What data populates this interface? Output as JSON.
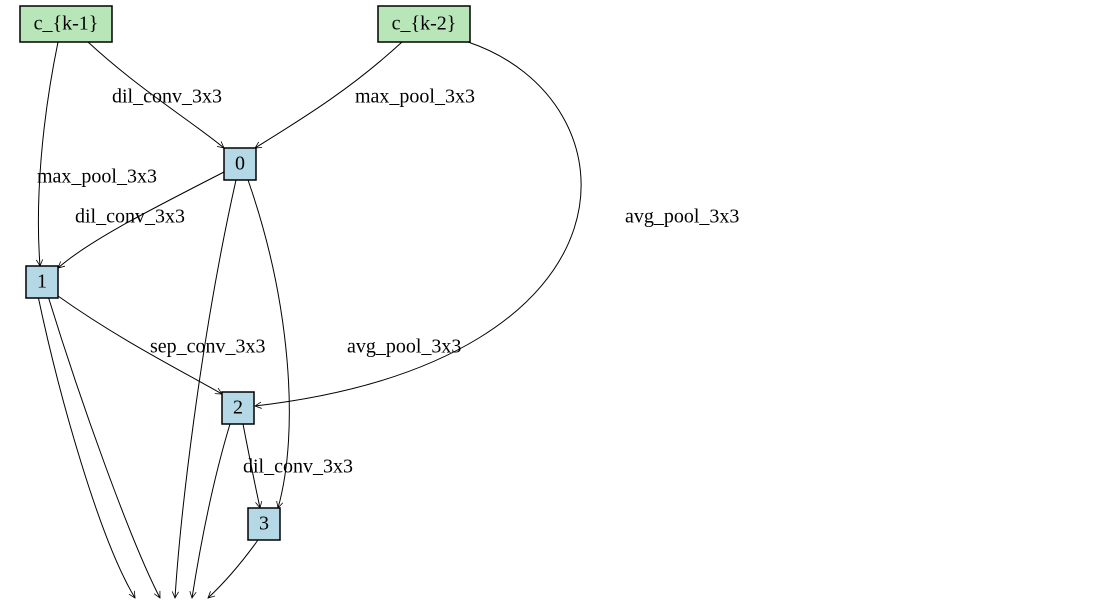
{
  "nodes": {
    "ck1": {
      "label": "c_{k-1}"
    },
    "ck2": {
      "label": "c_{k-2}"
    },
    "n0": {
      "label": "0"
    },
    "n1": {
      "label": "1"
    },
    "n2": {
      "label": "2"
    },
    "n3": {
      "label": "3"
    }
  },
  "edges": {
    "ck1_n0": {
      "label": "dil_conv_3x3"
    },
    "ck2_n0": {
      "label": "max_pool_3x3"
    },
    "ck1_n1": {
      "label": "max_pool_3x3"
    },
    "n0_n1": {
      "label": "dil_conv_3x3"
    },
    "n1_n2": {
      "label": "sep_conv_3x3"
    },
    "n0_n3": {
      "label": "avg_pool_3x3"
    },
    "ck2_n2": {
      "label": "avg_pool_3x3"
    },
    "n2_n3": {
      "label": "dil_conv_3x3"
    }
  }
}
